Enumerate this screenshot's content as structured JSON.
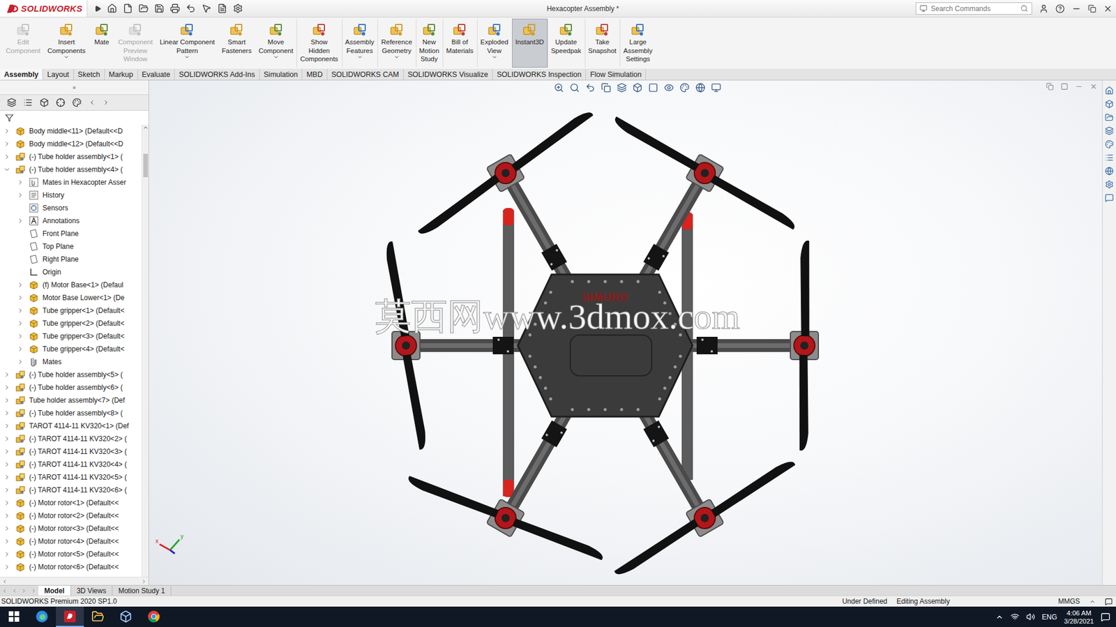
{
  "app": {
    "logo": "SOLIDWORKS"
  },
  "window": {
    "title": "Hexacopter Assembly *"
  },
  "search": {
    "placeholder": "Search Commands"
  },
  "ribbon": [
    {
      "lines": [
        "Edit",
        "Component"
      ],
      "disabled": true,
      "selected": false,
      "dropdown": false
    },
    {
      "lines": [
        "Insert",
        "Components"
      ],
      "disabled": false,
      "selected": false,
      "dropdown": true
    },
    {
      "lines": [
        "Mate"
      ],
      "disabled": false,
      "selected": false,
      "dropdown": false
    },
    {
      "lines": [
        "Component",
        "Preview",
        "Window"
      ],
      "disabled": true,
      "selected": false,
      "dropdown": false
    },
    {
      "lines": [
        "Linear Component",
        "Pattern"
      ],
      "disabled": false,
      "selected": false,
      "dropdown": true
    },
    {
      "lines": [
        "Smart",
        "Fasteners"
      ],
      "disabled": false,
      "selected": false,
      "dropdown": false
    },
    {
      "lines": [
        "Move",
        "Component"
      ],
      "disabled": false,
      "selected": false,
      "dropdown": true
    },
    {
      "lines": [
        "Show",
        "Hidden",
        "Components"
      ],
      "disabled": false,
      "selected": false,
      "dropdown": false
    },
    {
      "lines": [
        "Assembly",
        "Features"
      ],
      "disabled": false,
      "selected": false,
      "dropdown": true
    },
    {
      "lines": [
        "Reference",
        "Geometry"
      ],
      "disabled": false,
      "selected": false,
      "dropdown": true
    },
    {
      "lines": [
        "New",
        "Motion",
        "Study"
      ],
      "disabled": false,
      "selected": false,
      "dropdown": false
    },
    {
      "lines": [
        "Bill of",
        "Materials"
      ],
      "disabled": false,
      "selected": false,
      "dropdown": false
    },
    {
      "lines": [
        "Exploded",
        "View"
      ],
      "disabled": false,
      "selected": false,
      "dropdown": true
    },
    {
      "lines": [
        "Instant3D"
      ],
      "disabled": false,
      "selected": true,
      "dropdown": false
    },
    {
      "lines": [
        "Update",
        "Speedpak"
      ],
      "disabled": false,
      "selected": false,
      "dropdown": false
    },
    {
      "lines": [
        "Take",
        "Snapshot"
      ],
      "disabled": false,
      "selected": false,
      "dropdown": false
    },
    {
      "lines": [
        "Large",
        "Assembly",
        "Settings"
      ],
      "disabled": false,
      "selected": false,
      "dropdown": false
    }
  ],
  "tabs": [
    {
      "label": "Assembly",
      "selected": true
    },
    {
      "label": "Layout",
      "selected": false
    },
    {
      "label": "Sketch",
      "selected": false
    },
    {
      "label": "Markup",
      "selected": false
    },
    {
      "label": "Evaluate",
      "selected": false
    },
    {
      "label": "SOLIDWORKS Add-Ins",
      "selected": false
    },
    {
      "label": "Simulation",
      "selected": false
    },
    {
      "label": "MBD",
      "selected": false
    },
    {
      "label": "SOLIDWORKS CAM",
      "selected": false
    },
    {
      "label": "SOLIDWORKS Visualize",
      "selected": false
    },
    {
      "label": "SOLIDWORKS Inspection",
      "selected": false
    },
    {
      "label": "Flow Simulation",
      "selected": false
    }
  ],
  "tree": [
    {
      "label": "Body middle<11> (Default<<D",
      "level": 0,
      "kind": "part",
      "expandable": true,
      "expanded": false
    },
    {
      "label": "Body middle<12> (Default<<D",
      "level": 0,
      "kind": "part",
      "expandable": true,
      "expanded": false
    },
    {
      "label": "(-) Tube holder assembly<1> (",
      "level": 0,
      "kind": "assembly",
      "expandable": true,
      "expanded": false
    },
    {
      "label": "(-) Tube holder assembly<4> (",
      "level": 0,
      "kind": "assembly",
      "expandable": true,
      "expanded": true
    },
    {
      "label": "Mates in Hexacopter Asser",
      "level": 1,
      "kind": "mates-folder",
      "expandable": true,
      "expanded": false
    },
    {
      "label": "History",
      "level": 1,
      "kind": "history",
      "expandable": true,
      "expanded": false
    },
    {
      "label": "Sensors",
      "level": 1,
      "kind": "sensors",
      "expandable": false,
      "expanded": false
    },
    {
      "label": "Annotations",
      "level": 1,
      "kind": "annotations",
      "expandable": true,
      "expanded": false
    },
    {
      "label": "Front Plane",
      "level": 1,
      "kind": "plane",
      "expandable": false,
      "expanded": false
    },
    {
      "label": "Top Plane",
      "level": 1,
      "kind": "plane",
      "expandable": false,
      "expanded": false
    },
    {
      "label": "Right Plane",
      "level": 1,
      "kind": "plane",
      "expandable": false,
      "expanded": false
    },
    {
      "label": "Origin",
      "level": 1,
      "kind": "origin",
      "expandable": false,
      "expanded": false
    },
    {
      "label": "(f) Motor Base<1> (Defaul",
      "level": 1,
      "kind": "part",
      "expandable": true,
      "expanded": false
    },
    {
      "label": "Motor Base Lower<1> (De",
      "level": 1,
      "kind": "part",
      "expandable": true,
      "expanded": false
    },
    {
      "label": "Tube gripper<1> (Default<",
      "level": 1,
      "kind": "part",
      "expandable": true,
      "expanded": false
    },
    {
      "label": "Tube gripper<2> (Default<",
      "level": 1,
      "kind": "part",
      "expandable": true,
      "expanded": false
    },
    {
      "label": "Tube gripper<3> (Default<",
      "level": 1,
      "kind": "part",
      "expandable": true,
      "expanded": false
    },
    {
      "label": "Tube gripper<4> (Default<",
      "level": 1,
      "kind": "part",
      "expandable": true,
      "expanded": false
    },
    {
      "label": "Mates",
      "level": 1,
      "kind": "mates",
      "expandable": true,
      "expanded": false
    },
    {
      "label": "(-) Tube holder assembly<5> (",
      "level": 0,
      "kind": "assembly",
      "expandable": true,
      "expanded": false
    },
    {
      "label": "(-) Tube holder assembly<6> (",
      "level": 0,
      "kind": "assembly",
      "expandable": true,
      "expanded": false
    },
    {
      "label": "Tube holder assembly<7> (Def",
      "level": 0,
      "kind": "assembly",
      "expandable": true,
      "expanded": false
    },
    {
      "label": "(-) Tube holder assembly<8> (",
      "level": 0,
      "kind": "assembly",
      "expandable": true,
      "expanded": false
    },
    {
      "label": "TAROT 4114-11 KV320<1> (Def",
      "level": 0,
      "kind": "assembly",
      "expandable": true,
      "expanded": false
    },
    {
      "label": "(-) TAROT 4114-11 KV320<2> (",
      "level": 0,
      "kind": "assembly",
      "expandable": true,
      "expanded": false
    },
    {
      "label": "(-) TAROT 4114-11 KV320<3> (",
      "level": 0,
      "kind": "assembly",
      "expandable": true,
      "expanded": false
    },
    {
      "label": "(-) TAROT 4114-11 KV320<4> (",
      "level": 0,
      "kind": "assembly",
      "expandable": true,
      "expanded": false
    },
    {
      "label": "(-) TAROT 4114-11 KV320<5> (",
      "level": 0,
      "kind": "assembly",
      "expandable": true,
      "expanded": false
    },
    {
      "label": "(-) TAROT 4114-11 KV320<6> (",
      "level": 0,
      "kind": "assembly",
      "expandable": true,
      "expanded": false
    },
    {
      "label": "(-) Motor rotor<1> (Default<<",
      "level": 0,
      "kind": "part",
      "expandable": true,
      "expanded": false
    },
    {
      "label": "(-) Motor rotor<2> (Default<<",
      "level": 0,
      "kind": "part",
      "expandable": true,
      "expanded": false
    },
    {
      "label": "(-) Motor rotor<3> (Default<<",
      "level": 0,
      "kind": "part",
      "expandable": true,
      "expanded": false
    },
    {
      "label": "(-) Motor rotor<4> (Default<<",
      "level": 0,
      "kind": "part",
      "expandable": true,
      "expanded": false
    },
    {
      "label": "(-) Motor rotor<5> (Default<<",
      "level": 0,
      "kind": "part",
      "expandable": true,
      "expanded": false
    },
    {
      "label": "(-) Motor rotor<6> (Default<<",
      "level": 0,
      "kind": "part",
      "expandable": true,
      "expanded": false
    }
  ],
  "viewport": {
    "watermark": "莫西网www.3dmox.com",
    "model_logo": "SIMURG",
    "triad": [
      "x",
      "y"
    ]
  },
  "bottom_tabs": [
    {
      "label": "Model",
      "selected": true
    },
    {
      "label": "3D Views",
      "selected": false
    },
    {
      "label": "Motion Study 1",
      "selected": false
    }
  ],
  "status_bar": {
    "product": "SOLIDWORKS Premium 2020 SP1.0",
    "state": "Under Defined",
    "mode": "Editing Assembly",
    "units": "MMGS"
  },
  "taskbar": {
    "language": "ENG",
    "time": "4:06 AM",
    "date": "3/28/2021"
  }
}
